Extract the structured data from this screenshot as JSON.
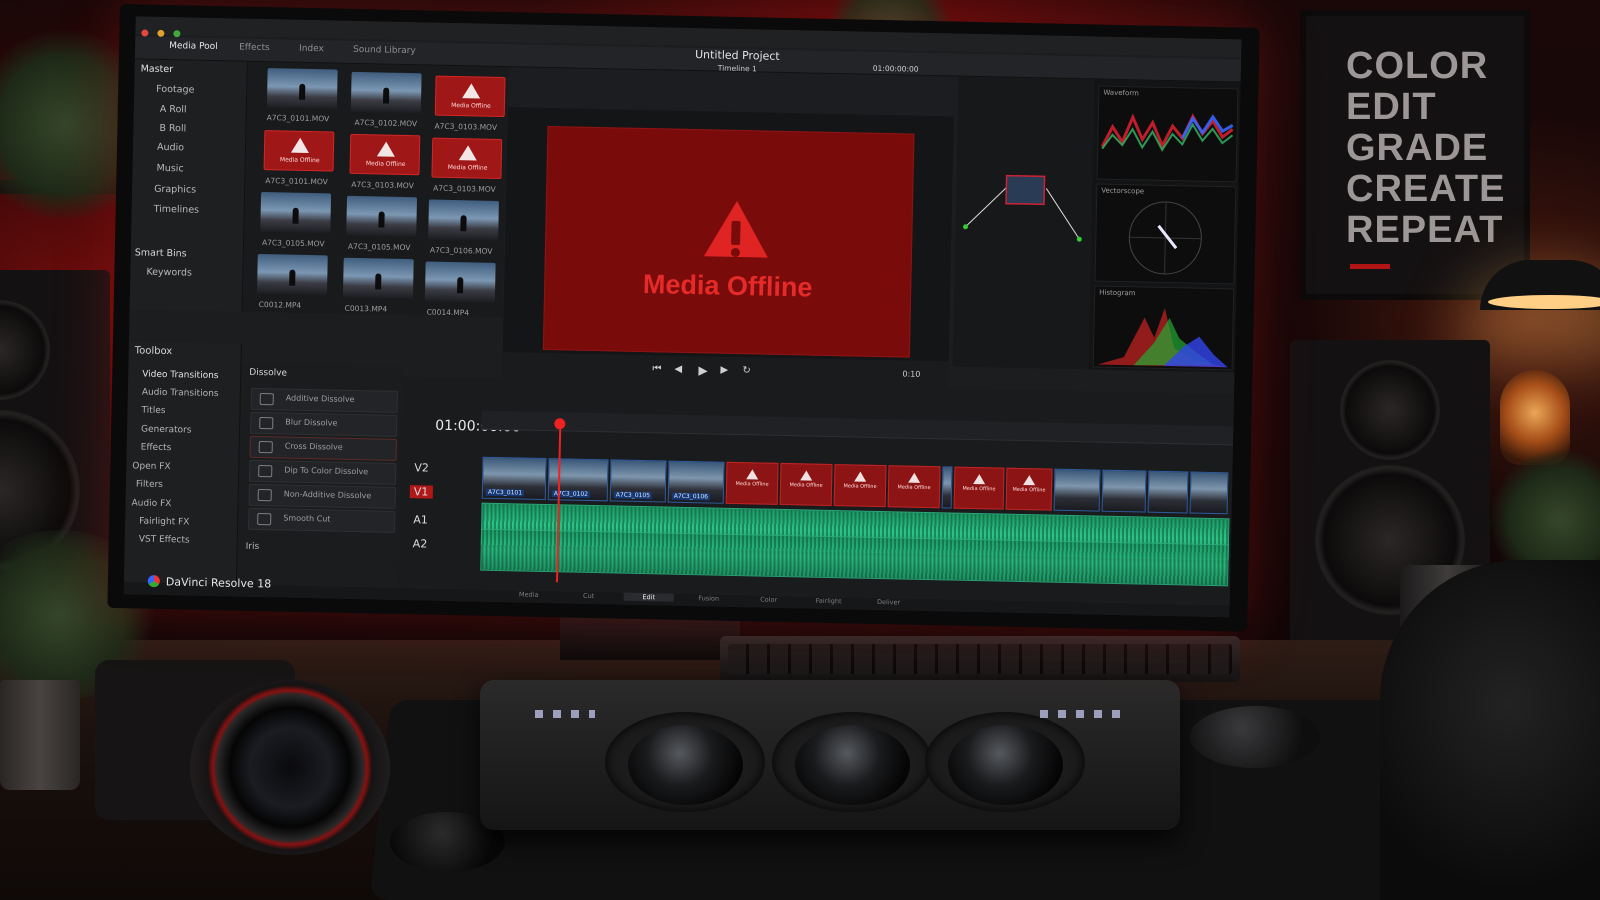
{
  "app": {
    "name": "DaVinci Resolve 18",
    "project_title": "Untitled Project",
    "timeline_name": "Timeline 1",
    "viewer_timecode": "01:00:00:00",
    "accent_color": "#e02424",
    "offline_color": "#8d1414",
    "audio_color": "#2cc486"
  },
  "tabs": [
    "Media Pool",
    "Effects",
    "Index",
    "Sound Library"
  ],
  "bins": {
    "master": "Master",
    "items": [
      "Footage",
      "A Roll",
      "B Roll",
      "Audio",
      "Music",
      "Graphics",
      "Timelines"
    ],
    "smart_bins": "Smart Bins",
    "keywords": "Keywords"
  },
  "media_pool": {
    "thumbs": [
      {
        "label": "A7C3_0101.MOV",
        "offline": false
      },
      {
        "label": "A7C3_0102.MOV",
        "offline": false
      },
      {
        "label": "A7C3_0103.MOV",
        "offline": true
      },
      {
        "label": "A7C3_0101.MOV",
        "offline": true
      },
      {
        "label": "A7C3_0103.MOV",
        "offline": true
      },
      {
        "label": "A7C3_0103.MOV",
        "offline": true
      },
      {
        "label": "A7C3_0105.MOV",
        "offline": false
      },
      {
        "label": "A7C3_0105.MOV",
        "offline": false
      },
      {
        "label": "A7C3_0106.MOV",
        "offline": false
      },
      {
        "label": "C0012.MP4",
        "offline": false
      },
      {
        "label": "C0013.MP4",
        "offline": false
      },
      {
        "label": "C0014.MP4",
        "offline": false
      }
    ],
    "offline_label": "Media Offline"
  },
  "viewer": {
    "message": "Media Offline",
    "playback_timecode": "01:00:00:00",
    "frame": "0:10"
  },
  "scopes": [
    "Waveform",
    "Vectorscope",
    "Histogram"
  ],
  "toolbox": {
    "title": "Toolbox",
    "items": [
      "Video Transitions",
      "Audio Transitions",
      "Titles",
      "Generators",
      "Effects",
      "Open FX",
      "Filters",
      "Audio FX",
      "Fairlight FX",
      "VST Effects"
    ]
  },
  "effects": {
    "category": "Dissolve",
    "items": [
      "Additive Dissolve",
      "Blur Dissolve",
      "Cross Dissolve",
      "Dip To Color Dissolve",
      "Non-Additive Dissolve",
      "Smooth Cut"
    ],
    "next_category": "Iris"
  },
  "timeline": {
    "timecode": "01:00:00:00",
    "tracks": [
      "V2",
      "V1",
      "A1",
      "A2"
    ]
  },
  "pages": [
    "Media",
    "Cut",
    "Edit",
    "Fusion",
    "Color",
    "Fairlight",
    "Deliver"
  ],
  "poster": {
    "lines": [
      "COLOR",
      "EDIT",
      "GRADE",
      "CREATE",
      "REPEAT"
    ]
  }
}
